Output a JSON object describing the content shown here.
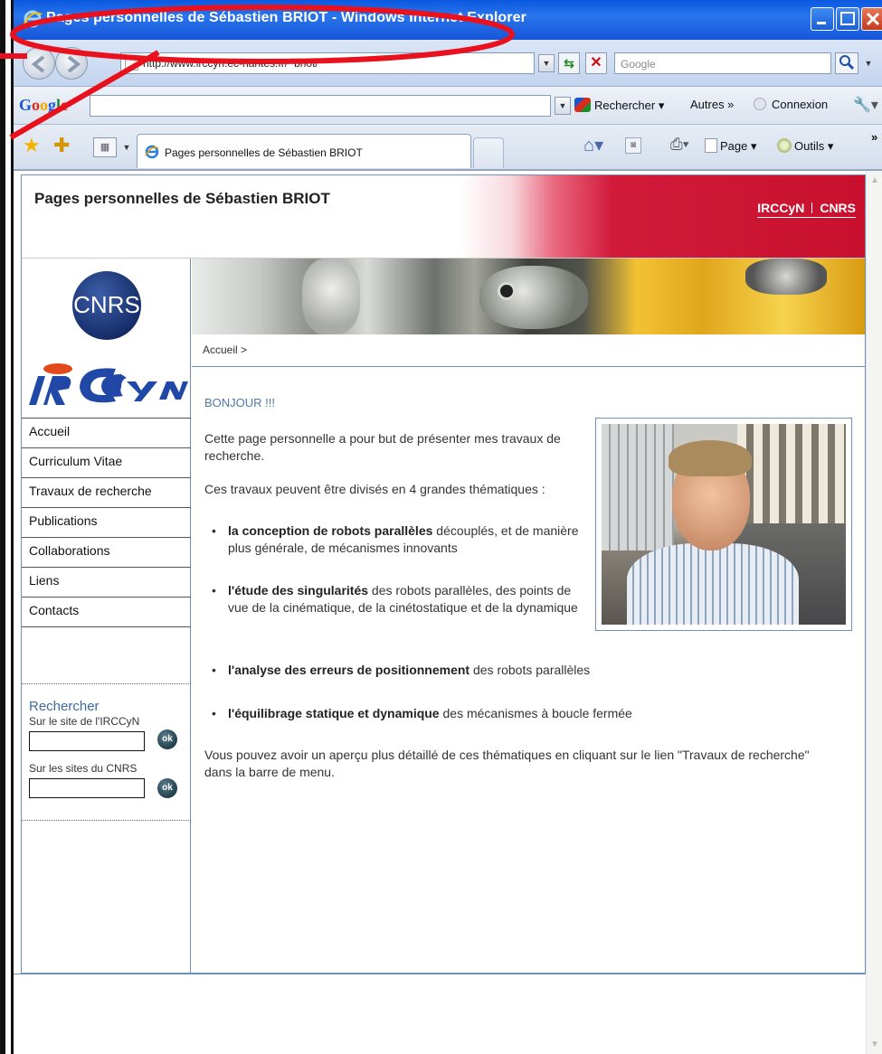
{
  "window": {
    "title": "Pages personnelles de Sébastien BRIOT - Windows Internet Explorer"
  },
  "addressbar": {
    "url": "http://www.irccyn.ec-nantes.fr/~briot/",
    "search_placeholder": "Google"
  },
  "googlebar": {
    "logo": [
      "G",
      "o",
      "o",
      "g",
      "l",
      "e"
    ],
    "search_label": "Rechercher",
    "more_label": "Autres »",
    "connect_label": "Connexion"
  },
  "tabbar": {
    "tab_title": "Pages personnelles de Sébastien BRIOT",
    "page_label": "Page",
    "tools_label": "Outils",
    "more": "»"
  },
  "site": {
    "title": "Pages personnelles de Sébastien BRIOT",
    "links": [
      "IRCCyN",
      "CNRS"
    ],
    "cnrs_logo": "CNRS",
    "breadcrumb": "Accueil >",
    "menu": [
      "Accueil",
      "Curriculum Vitae",
      "Travaux de recherche",
      "Publications",
      "Collaborations",
      "Liens",
      "Contacts"
    ],
    "search": {
      "title": "Rechercher",
      "label1": "Sur le site de l'IRCCyN",
      "label2": "Sur les sites du CNRS",
      "ok": "ok"
    }
  },
  "main": {
    "greeting": "BONJOUR !!!",
    "intro": "Cette page personnelle a pour but de présenter mes travaux de recherche.",
    "themes_intro": "Ces travaux peuvent être divisés en 4 grandes thématiques :",
    "themes": [
      {
        "bold": "la conception de robots parallèles",
        "rest": " découplés, et de manière plus générale, de mécanismes innovants"
      },
      {
        "bold": "l'étude des singularités",
        "rest": " des robots parallèles, des points de vue de la cinématique, de la cinétostatique et de la dynamique"
      },
      {
        "bold": "l'analyse des erreurs de positionnement",
        "rest": " des robots parallèles"
      },
      {
        "bold": "l'équilibrage statique et dynamique",
        "rest": " des mécanismes à boucle fermée"
      }
    ],
    "outro": "Vous pouvez avoir un aperçu plus détaillé de ces thématiques en cliquant sur le lien \"Travaux de recherche\" dans la barre de menu."
  },
  "colors": {
    "annotation_red": "#e8111d",
    "header_red": "#c8102e",
    "heading_blue": "#4f79a6"
  }
}
